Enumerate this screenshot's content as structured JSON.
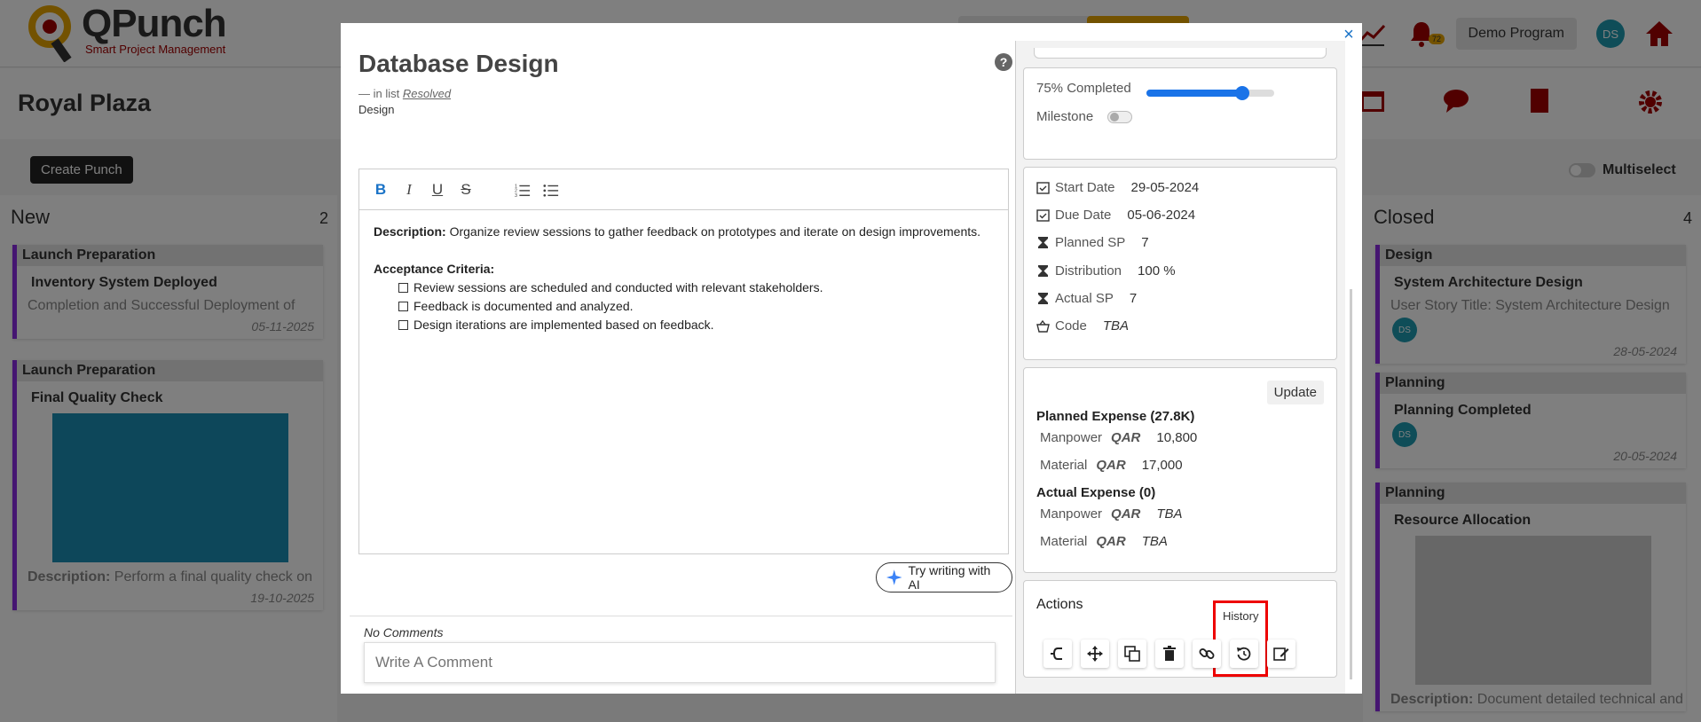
{
  "app": {
    "logo_title": "QPunch",
    "logo_subtitle": "Smart Project Management",
    "program_button": "Demo Program",
    "user_initials": "DS",
    "bell_count": "72",
    "project_title": "Royal Plaza",
    "create_button": "Create Punch",
    "multiselect_label": "Multiselect"
  },
  "columns": {
    "new": {
      "title": "New",
      "count": "2",
      "cards": [
        {
          "group": "Launch Preparation",
          "title": "Inventory System Deployed",
          "desc": "Completion and Successful Deployment of",
          "date": "05-11-2025"
        },
        {
          "group": "Launch Preparation",
          "title": "Final Quality Check",
          "desc_label": "Description:",
          "desc": "Perform a final quality check on",
          "date": "19-10-2025"
        }
      ]
    },
    "closed": {
      "title": "Closed",
      "count": "4",
      "cards": [
        {
          "group": "Design",
          "title": "System Architecture Design",
          "desc": "User Story Title: System Architecture Design",
          "date": "28-05-2024"
        },
        {
          "group": "Planning",
          "title": "Planning Completed",
          "date": "20-05-2024"
        },
        {
          "group": "Planning",
          "title": "Resource Allocation",
          "desc_label": "Description:",
          "desc": "Document detailed technical and"
        }
      ]
    }
  },
  "modal": {
    "title": "Database Design",
    "in_list_prefix": "— in list",
    "in_list_name": "Resolved",
    "category": "Design",
    "editor": {
      "description_label": "Description:",
      "description_text": "Organize review sessions to gather feedback on prototypes and iterate on design improvements.",
      "acceptance_label": "Acceptance Criteria:",
      "criteria": [
        "Review sessions are scheduled and conducted with relevant stakeholders.",
        "Feedback is documented and analyzed.",
        "Design iterations are implemented based on feedback."
      ]
    },
    "ai_button": "Try writing with AI",
    "no_comments": "No Comments",
    "comment_placeholder": "Write A Comment"
  },
  "progress": {
    "label": "75% Completed",
    "percent": 75,
    "milestone_label": "Milestone"
  },
  "details": {
    "start_date_label": "Start Date",
    "start_date": "29-05-2024",
    "due_date_label": "Due Date",
    "due_date": "05-06-2024",
    "planned_sp_label": "Planned SP",
    "planned_sp": "7",
    "distribution_label": "Distribution",
    "distribution": "100 %",
    "actual_sp_label": "Actual SP",
    "actual_sp": "7",
    "code_label": "Code",
    "code": "TBA"
  },
  "expenses": {
    "update_button": "Update",
    "planned_title": "Planned Expense (27.8K)",
    "actual_title": "Actual Expense (0)",
    "currency": "QAR",
    "manpower_label": "Manpower",
    "material_label": "Material",
    "planned_manpower": "10,800",
    "planned_material": "17,000",
    "actual_manpower": "TBA",
    "actual_material": "TBA"
  },
  "actions": {
    "title": "Actions",
    "history_tooltip": "History"
  },
  "colors": {
    "accent_blue": "#1a73e8",
    "highlight_red": "#ee0000",
    "brand_gold": "#e6a400"
  }
}
